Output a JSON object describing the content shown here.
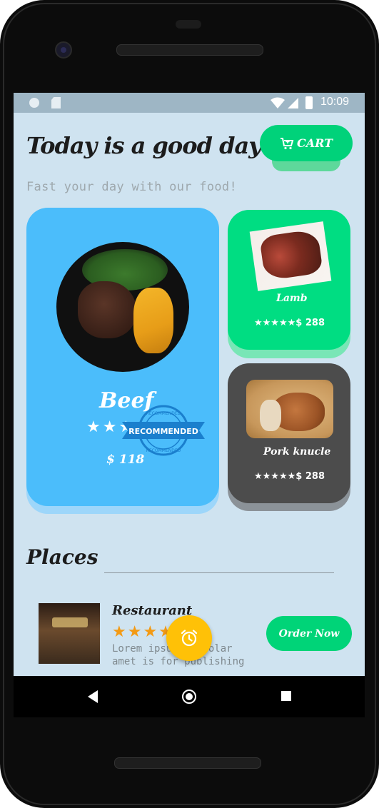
{
  "status_bar": {
    "time": "10:09"
  },
  "header": {
    "title": "Today is a good day",
    "subtitle": "Fast your day with our food!",
    "cart_label": "CART",
    "cart_icon": "cart-icon"
  },
  "featured": {
    "name": "Beef",
    "stars": "★★★★★",
    "price": "$ 118",
    "badge_text": "RECOMMENDED",
    "badge_ring_text": "RECOMMENDED",
    "rating": 5
  },
  "cards": [
    {
      "name": "Lamb",
      "stars": "★★★★★",
      "price": "$ 288",
      "color": "#00dd82"
    },
    {
      "name": "Pork knucle",
      "stars": "★★★★★",
      "price": "$ 288",
      "color": "#4c4c4c"
    }
  ],
  "places": {
    "title": "Places",
    "items": [
      {
        "name": "Restaurant",
        "stars": "★★★★★",
        "description": "Lorem ipsum is dolar amet is for publishing",
        "order_label": "Order Now"
      }
    ]
  },
  "colors": {
    "accent_green": "#00d27a",
    "featured_blue": "#4bbdfb",
    "fab_yellow": "#ffc107",
    "background": "#cfe3f0"
  },
  "fab": {
    "icon": "alarm-icon"
  }
}
